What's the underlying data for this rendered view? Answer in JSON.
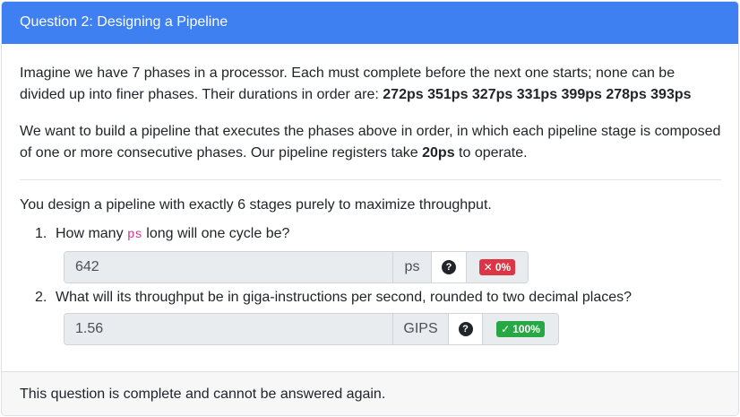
{
  "header": {
    "title": "Question 2: Designing a Pipeline"
  },
  "intro": {
    "p1_text": "Imagine we have 7 phases in a processor. Each must complete before the next one starts; none can be divided up into finer phases. Their durations in order are: ",
    "durations": "272ps 351ps 327ps 331ps 399ps 278ps 393ps",
    "p2_before": "We want to build a pipeline that executes the phases above in order, in which each pipeline stage is composed of one or more consecutive phases. Our pipeline registers take ",
    "register_time": "20ps",
    "p2_after": " to operate."
  },
  "scenario": "You design a pipeline with exactly 6 stages purely to maximize throughput.",
  "questions": [
    {
      "number": "1.",
      "text_before": "How many ",
      "code": "ps",
      "text_after": " long will one cycle be?",
      "answer_value": "642",
      "unit": "ps",
      "help_icon": "question-circle-icon",
      "help_glyph": "?",
      "score_icon": "✕",
      "score_text": "0%",
      "score_status": "incorrect",
      "score_color": "#dc3545"
    },
    {
      "number": "2.",
      "text_before": "What will its throughput be in giga-instructions per second, rounded to two decimal places?",
      "code": "",
      "text_after": "",
      "answer_value": "1.56",
      "unit": "GIPS",
      "help_icon": "question-circle-icon",
      "help_glyph": "?",
      "score_icon": "✓",
      "score_text": "100%",
      "score_status": "correct",
      "score_color": "#28a745"
    }
  ],
  "footer": {
    "text": "This question is complete and cannot be answered again."
  },
  "colors": {
    "header_bg": "#3e7ff2",
    "footer_bg": "#f7f7f7",
    "input_bg": "#e9ecef",
    "code_color": "#d63384"
  }
}
